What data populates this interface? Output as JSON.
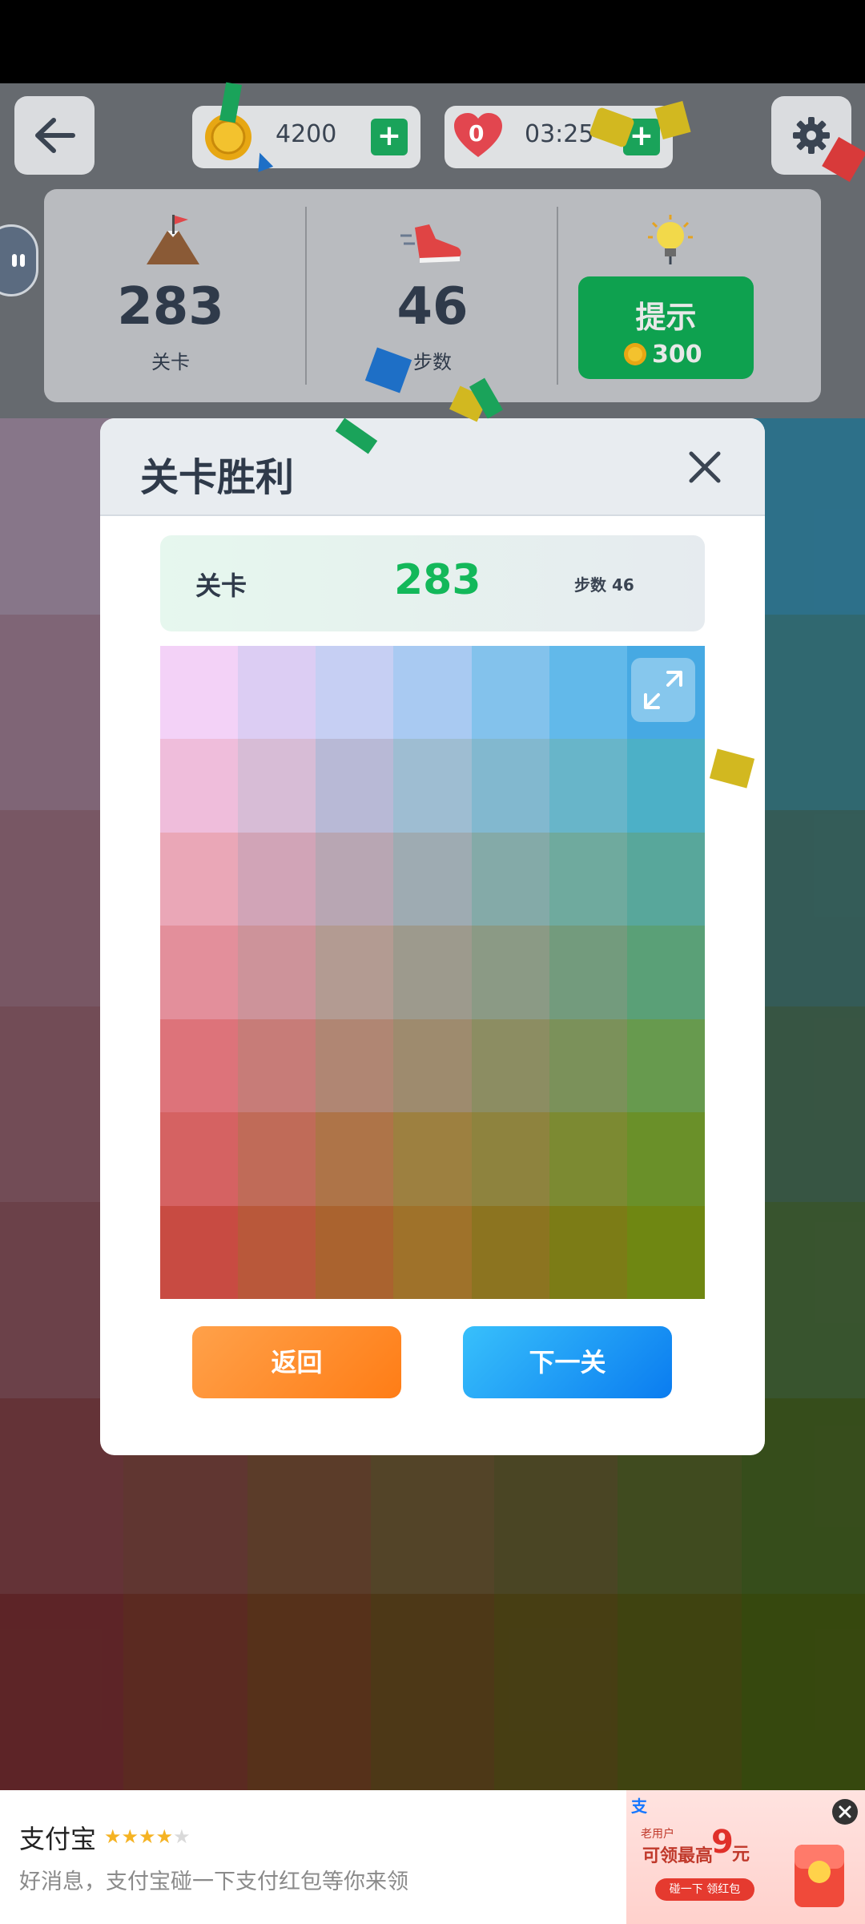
{
  "header": {
    "coins": "4200",
    "timer": "03:25",
    "heart_count": "0"
  },
  "stats": {
    "level_value": "283",
    "level_label": "关卡",
    "steps_value": "46",
    "steps_label": "步数",
    "hint_label": "提示",
    "hint_cost": "300"
  },
  "dialog": {
    "title": "关卡胜利",
    "level_label": "关卡",
    "level_value": "283",
    "steps_text": "步数 46",
    "back_label": "返回",
    "next_label": "下一关"
  },
  "palette": {
    "rows": [
      [
        "#f3d2f7",
        "#dccdf3",
        "#c6cff3",
        "#a9caf2",
        "#83c2ec",
        "#62b9ea",
        "#46a9e3"
      ],
      [
        "#efbddb",
        "#d7bcd6",
        "#b8b9d6",
        "#9ebdd2",
        "#82b8cf",
        "#68b5c9",
        "#4cb0c7"
      ],
      [
        "#eaa7b7",
        "#d1a4b7",
        "#b8a6b3",
        "#9eabb2",
        "#84aaa8",
        "#6faa9e",
        "#58a79b"
      ],
      [
        "#e38f9b",
        "#cd939a",
        "#b39b92",
        "#9d9a8d",
        "#8b9a85",
        "#739b7d",
        "#5aa077"
      ],
      [
        "#dd737a",
        "#c77c78",
        "#b08673",
        "#9e8b6e",
        "#8c8d62",
        "#7b915a",
        "#679a4e"
      ],
      [
        "#d56262",
        "#c06b58",
        "#ae7448",
        "#9d8040",
        "#8e833e",
        "#7c8a32",
        "#6a9029"
      ],
      [
        "#c84b42",
        "#b9583a",
        "#aa632f",
        "#9f722a",
        "#8c7420",
        "#7c7c16",
        "#6f8712"
      ]
    ]
  },
  "background": {
    "rows": [
      [
        "#a591a8",
        "#a395b0",
        "#9c9db5",
        "#8ea4b6",
        "#7aa1b6",
        "#5f9eb7",
        "#3789a8"
      ],
      [
        "#9c7c90",
        "#977c92",
        "#8c7f95",
        "#7d8896",
        "#6b8d93",
        "#54898d",
        "#3b7f89"
      ],
      [
        "#936b7a",
        "#8d6b79",
        "#856e7a",
        "#77727a",
        "#697876",
        "#547773",
        "#40706b"
      ],
      [
        "#8c5d6a",
        "#875c66",
        "#806062",
        "#73645f",
        "#65675b",
        "#556a58",
        "#446852"
      ],
      [
        "#83505a",
        "#7f5052",
        "#78574c",
        "#6c5c46",
        "#5f5f40",
        "#53643c",
        "#456739"
      ],
      [
        "#7b3f44",
        "#76433c",
        "#6f4a33",
        "#665331",
        "#5b552c",
        "#4f5c27",
        "#435e22"
      ],
      [
        "#722d30",
        "#6f3429",
        "#6a3c20",
        "#5f451d",
        "#574c18",
        "#4d5214",
        "#435812"
      ]
    ]
  },
  "ad": {
    "app_name": "支付宝",
    "rating": 4,
    "text": "好消息，支付宝碰一下支付红包等你来领",
    "badge": "支",
    "banner_line1": "老用户",
    "banner_line2": "可领最高",
    "banner_amount": "9",
    "banner_unit": "元",
    "banner_button": "碰一下 领红包"
  },
  "colors": {
    "green": "#0ea14f",
    "orange": "#ff8a25",
    "blue": "#1a8ff0",
    "number_green": "#13b85a"
  },
  "icons": [
    "back-arrow-icon",
    "coin-icon",
    "heart-icon",
    "gear-icon",
    "flag-mountain-icon",
    "shoe-icon",
    "lightbulb-icon",
    "close-icon",
    "expand-icon",
    "star-icon"
  ]
}
